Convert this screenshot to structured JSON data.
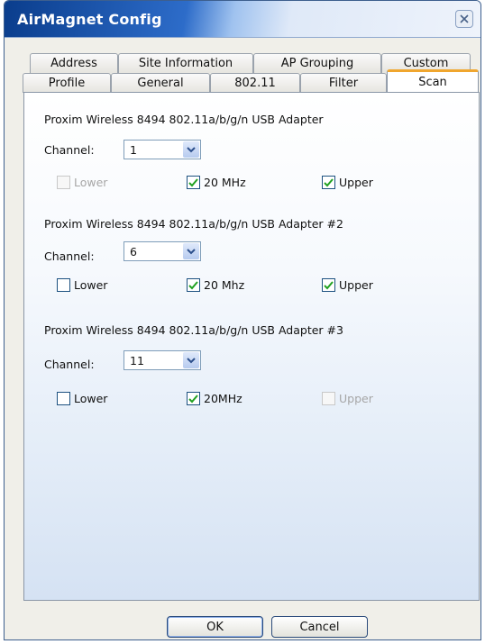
{
  "window": {
    "title": "AirMagnet Config"
  },
  "tabs": {
    "row1": [
      "Address",
      "Site Information",
      "AP Grouping",
      "Custom"
    ],
    "row2": [
      "Profile",
      "General",
      "802.11",
      "Filter",
      "Scan"
    ],
    "active": "Scan"
  },
  "adapters": [
    {
      "name": "Proxim Wireless 8494 802.11a/b/g/n USB Adapter",
      "channel_label": "Channel:",
      "channel": "1",
      "lower": {
        "label": "Lower",
        "checked": false,
        "enabled": false
      },
      "mid": {
        "label": "20 MHz",
        "checked": true,
        "enabled": true
      },
      "upper": {
        "label": "Upper",
        "checked": true,
        "enabled": true
      }
    },
    {
      "name": "Proxim Wireless 8494 802.11a/b/g/n USB Adapter #2",
      "channel_label": "Channel:",
      "channel": "6",
      "lower": {
        "label": "Lower",
        "checked": false,
        "enabled": true
      },
      "mid": {
        "label": "20 Mhz",
        "checked": true,
        "enabled": true
      },
      "upper": {
        "label": "Upper",
        "checked": true,
        "enabled": true
      }
    },
    {
      "name": "Proxim Wireless 8494 802.11a/b/g/n USB Adapter #3",
      "channel_label": "Channel:",
      "channel": "11",
      "lower": {
        "label": "Lower",
        "checked": false,
        "enabled": true
      },
      "mid": {
        "label": "20MHz",
        "checked": true,
        "enabled": true
      },
      "upper": {
        "label": "Upper",
        "checked": false,
        "enabled": false
      }
    }
  ],
  "buttons": {
    "ok": "OK",
    "cancel": "Cancel"
  }
}
